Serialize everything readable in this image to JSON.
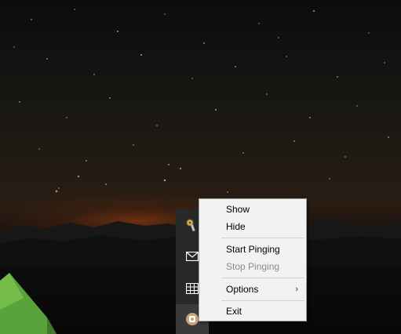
{
  "context_menu": {
    "items": [
      {
        "label": "Show",
        "enabled": true
      },
      {
        "label": "Hide",
        "enabled": true
      },
      {
        "label": "Start Pinging",
        "enabled": true
      },
      {
        "label": "Stop Pinging",
        "enabled": false
      },
      {
        "label": "Options",
        "enabled": true,
        "has_submenu": true
      },
      {
        "label": "Exit",
        "enabled": true
      }
    ],
    "submenu_arrow": "›"
  },
  "tray": {
    "icons": [
      "keys-icon",
      "mail-icon",
      "grid-app-icon",
      "ping-app-icon"
    ],
    "active_icon": "ping-app-icon"
  },
  "colors": {
    "menu_bg": "#f2f2f2",
    "menu_border": "#a0a0a0",
    "disabled_text": "#8a8a8a",
    "tray_bg": "#282828",
    "tent_green": "#5aa23a"
  }
}
